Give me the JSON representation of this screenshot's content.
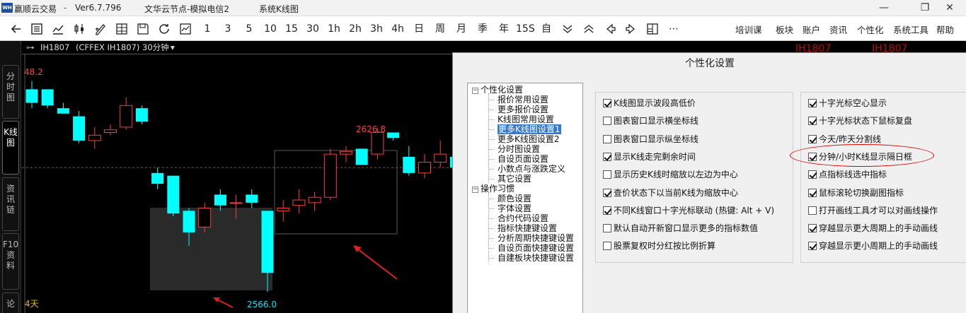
{
  "window": {
    "app_title": "赢顺云交易",
    "version": "Ver6.7.796",
    "server": "文华云节点-模拟电信2",
    "panel": "系统K线图",
    "minimize_glyph": "—",
    "maximize_glyph": "❐",
    "close_glyph": "✕"
  },
  "toolbar": {
    "periods": [
      "1",
      "3",
      "5",
      "10",
      "15",
      "30",
      "1h",
      "2h",
      "3h",
      "4h",
      "日",
      "周",
      "月",
      "季",
      "年",
      "15S",
      "自"
    ],
    "more_glyph": "⋯",
    "menus": [
      "培训课",
      "板块",
      "账户",
      "资讯",
      "个性化",
      "系统工具",
      "帮助"
    ],
    "icons": [
      "back-icon",
      "list-icon",
      "line-chart-icon",
      "candle-icon",
      "draw-icon",
      "stack-icon",
      "save-icon",
      "refresh-icon",
      "window-chart-icon",
      "chevron-down-double-icon",
      "chevron-up-double-icon",
      "arrow-left-icon",
      "arrow-right-icon",
      "grid-icon"
    ]
  },
  "sidetabs": [
    "分时图",
    "K线图",
    "资讯链",
    "F10资料",
    "论"
  ],
  "chart": {
    "contract": "IH1807",
    "contract_full": "(CFFEX IH1807)",
    "period": "30分钟",
    "dropdown_glyph": "▾",
    "high_label": "48.2",
    "peak_label": "2626.8",
    "low_label": "2566.0",
    "days_label": "4天",
    "colors": {
      "up": "#ff3b3b",
      "down": "#00ffff",
      "grid": "#c03030",
      "box": "#3a3a3a"
    },
    "right_labels": [
      "IH1807",
      "IH1807"
    ]
  },
  "chart_data": {
    "type": "candlestick",
    "title": "",
    "candles": [
      {
        "o": 2641,
        "c": 2636,
        "h": 2644,
        "l": 2634
      },
      {
        "o": 2641,
        "c": 2635,
        "h": 2641,
        "l": 2634
      },
      {
        "o": 2634,
        "c": 2632,
        "h": 2636,
        "l": 2632
      },
      {
        "o": 2631,
        "c": 2622,
        "h": 2633,
        "l": 2621
      },
      {
        "o": 2622,
        "c": 2624,
        "h": 2627,
        "l": 2619
      },
      {
        "o": 2625,
        "c": 2626,
        "h": 2628,
        "l": 2624
      },
      {
        "o": 2627,
        "c": 2635,
        "h": 2638,
        "l": 2626
      },
      {
        "o": 2634,
        "c": 2629,
        "h": 2635,
        "l": 2628
      },
      {
        "o": 2610,
        "c": 2606,
        "h": 2612,
        "l": 2604
      },
      {
        "o": 2609,
        "c": 2595,
        "h": 2609,
        "l": 2594
      },
      {
        "o": 2596,
        "c": 2588,
        "h": 2597,
        "l": 2583
      },
      {
        "o": 2590,
        "c": 2597,
        "h": 2599,
        "l": 2588
      },
      {
        "o": 2602,
        "c": 2598,
        "h": 2604,
        "l": 2596
      },
      {
        "o": 2599,
        "c": 2599,
        "h": 2602,
        "l": 2593
      },
      {
        "o": 2602,
        "c": 2599,
        "h": 2604,
        "l": 2597
      },
      {
        "o": 2596,
        "c": 2573,
        "h": 2596,
        "l": 2566
      },
      {
        "o": 2596,
        "c": 2597,
        "h": 2600,
        "l": 2592
      },
      {
        "o": 2598,
        "c": 2600,
        "h": 2604,
        "l": 2595
      },
      {
        "o": 2599,
        "c": 2601,
        "h": 2603,
        "l": 2596
      },
      {
        "o": 2601,
        "c": 2617,
        "h": 2619,
        "l": 2600
      },
      {
        "o": 2617,
        "c": 2618,
        "h": 2620,
        "l": 2614
      },
      {
        "o": 2619,
        "c": 2613,
        "h": 2619,
        "l": 2613
      },
      {
        "o": 2617,
        "c": 2625,
        "h": 2626.8,
        "l": 2615
      },
      {
        "o": 2625,
        "c": 2623,
        "h": 2625,
        "l": 2622
      },
      {
        "o": 2616,
        "c": 2610,
        "h": 2620,
        "l": 2609
      },
      {
        "o": 2610,
        "c": 2614,
        "h": 2617,
        "l": 2608
      },
      {
        "o": 2614,
        "c": 2617,
        "h": 2622,
        "l": 2612
      },
      {
        "o": 2616,
        "c": 2612,
        "h": 2617,
        "l": 2611
      }
    ],
    "reference_line": 2612
  },
  "dialog": {
    "title": "个性化设置",
    "tree": [
      {
        "label": "个性化设置",
        "level": 0,
        "expander": "−"
      },
      {
        "label": "报价常用设置",
        "level": 1
      },
      {
        "label": "更多报价设置",
        "level": 1
      },
      {
        "label": "K线图常用设置",
        "level": 1
      },
      {
        "label": "更多K线图设置1",
        "level": 1,
        "selected": true
      },
      {
        "label": "更多K线图设置2",
        "level": 1
      },
      {
        "label": "分时图设置",
        "level": 1
      },
      {
        "label": "自设页面设置",
        "level": 1
      },
      {
        "label": "小数点与涨跌定义",
        "level": 1
      },
      {
        "label": "其它设置",
        "level": 1
      },
      {
        "label": "操作习惯",
        "level": 0,
        "expander": "−"
      },
      {
        "label": "颜色设置",
        "level": 1
      },
      {
        "label": "字体设置",
        "level": 1
      },
      {
        "label": "合约代码设置",
        "level": 1
      },
      {
        "label": "指标快捷键设置",
        "level": 1
      },
      {
        "label": "分析周期快捷键设置",
        "level": 1
      },
      {
        "label": "自设页面快捷键设置",
        "level": 1
      },
      {
        "label": "自建板块快捷键设置",
        "level": 1
      }
    ],
    "options_left": [
      {
        "label": "K线图显示波段高低价",
        "checked": true
      },
      {
        "label": "图表窗口显示横坐标线",
        "checked": false
      },
      {
        "label": "图表窗口显示纵坐标线",
        "checked": false
      },
      {
        "label": "显示K线走完剩余时间",
        "checked": true
      },
      {
        "label": "显示历史K线时缩放以左边为中心",
        "checked": false
      },
      {
        "label": "查价状态下以当前K线为缩放中心",
        "checked": true
      },
      {
        "label": "不同K线窗口十字光标联动 (热键: Alt + V)",
        "checked": true
      },
      {
        "label": "默认自动开新窗口显示更多的指标数值",
        "checked": false
      },
      {
        "label": "股票复权时分红按比例折算",
        "checked": false
      }
    ],
    "options_right": [
      {
        "label": "十字光标空心显示",
        "checked": true
      },
      {
        "label": "十字光标状态下鼠标复盘",
        "checked": true
      },
      {
        "label": "今天/昨天分割线",
        "checked": true
      },
      {
        "label": "分钟/小时K线显示隔日框",
        "checked": true
      },
      {
        "label": "点指标线选中指标",
        "checked": true
      },
      {
        "label": "鼠标滚轮切换副图指标",
        "checked": true
      },
      {
        "label": "打开画线工具才可以对画线操作",
        "checked": false
      },
      {
        "label": "穿越显示更大周期上的手动画线",
        "checked": true
      },
      {
        "label": "穿越显示更小周期上的手动画线",
        "checked": true
      }
    ]
  }
}
